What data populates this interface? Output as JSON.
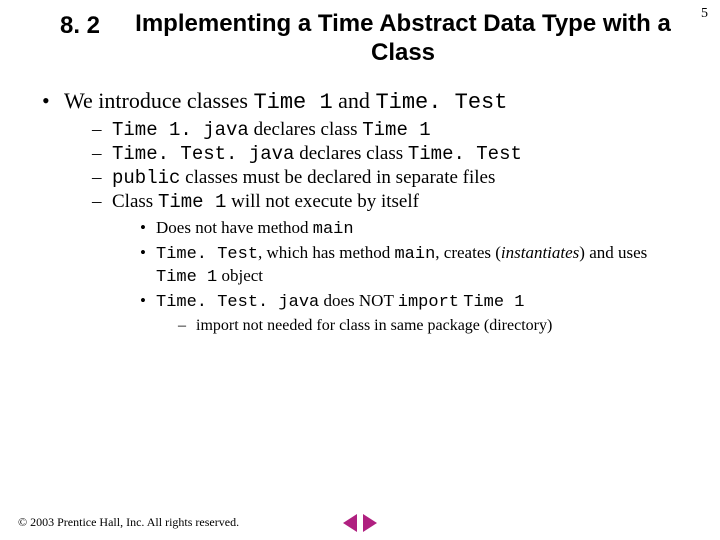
{
  "page_number": "5",
  "section_number": "8. 2",
  "title": "Implementing a Time Abstract Data Type with a Class",
  "bullets": {
    "l1_prefix": "We introduce classes ",
    "l1_code1": "Time 1",
    "l1_mid": " and ",
    "l1_code2": "Time. Test",
    "l2": [
      {
        "code": "Time 1. java",
        "mid": " declares class ",
        "code2": "Time 1"
      },
      {
        "code": "Time. Test. java",
        "mid": " declares class ",
        "code2": "Time. Test"
      },
      {
        "code": "public",
        "mid": " classes must be declared in separate files",
        "code2": ""
      },
      {
        "prefix": "Class ",
        "code": "Time 1",
        "mid": " will not execute by itself",
        "code2": ""
      }
    ],
    "l3": [
      {
        "prefix": "Does not have method ",
        "code": "main"
      },
      {
        "code": "Time. Test",
        "mid1": ", which has method ",
        "code2": "main",
        "mid2": ", creates (",
        "ital": "instantiates",
        "mid3": ") and uses ",
        "code3": "Time 1",
        "suffix": " object"
      },
      {
        "code": "Time. Test. java",
        "mid": " does NOT ",
        "code2": "import",
        "sp": " ",
        "code3": "Time 1"
      }
    ],
    "l4": "import not needed for class in same package (directory)"
  },
  "footer": "© 2003 Prentice Hall, Inc. All rights reserved."
}
